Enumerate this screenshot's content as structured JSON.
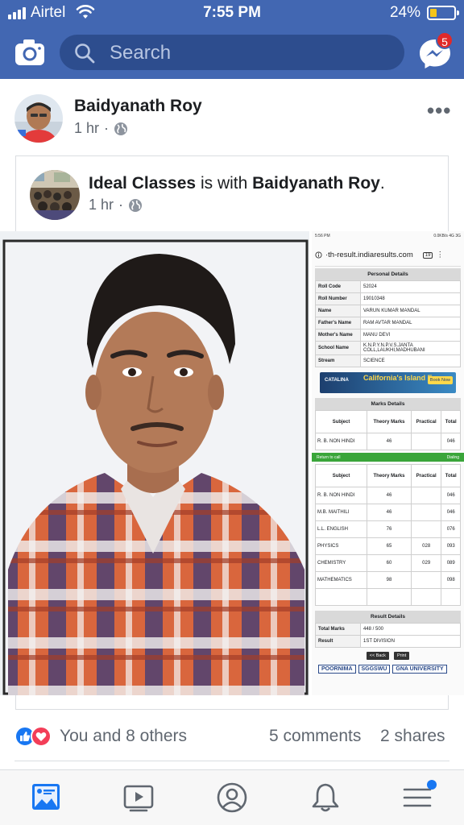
{
  "status_bar": {
    "carrier": "Airtel",
    "time": "7:55 PM",
    "battery_percent": "24%",
    "battery_level": 0.24
  },
  "header": {
    "search_placeholder": "Search",
    "messenger_badge": "5",
    "colors": {
      "bar": "#4267b2",
      "search": "#2d4d8e",
      "badge": "#e02929"
    }
  },
  "post": {
    "author": "Baidyanath Roy",
    "time": "1 hr",
    "separator": "·",
    "more_label": "•••",
    "audience_icon": "globe-icon"
  },
  "shared_post": {
    "page_name": "Ideal Classes",
    "with_text": "is with",
    "tagged": "Baidyanath Roy",
    "period": ".",
    "time": "1 hr",
    "separator": "·"
  },
  "result_screenshot": {
    "status_time": "5:56 PM",
    "status_right": "0.0KB/s 4G 3G",
    "url": "·th-result.indiaresults.com",
    "tab_count": "19",
    "personal_heading": "Personal Details",
    "personal": [
      {
        "k": "Roll Code",
        "v": "52024"
      },
      {
        "k": "Roll Number",
        "v": "19010348"
      },
      {
        "k": "Name",
        "v": "VARUN KUMAR MANDAL"
      },
      {
        "k": "Father's Name",
        "v": "RAM AVTAR MANDAL"
      },
      {
        "k": "Mother's Name",
        "v": "MANU DEVI"
      },
      {
        "k": "School Name",
        "v": "K.N.P.Y.N.P.V.S.JANTA COLL,LAUKHI,MADHUBANI"
      },
      {
        "k": "Stream",
        "v": "SCIENCE"
      }
    ],
    "ad": {
      "brand": "CATALINA",
      "headline": "California's Island Escape",
      "cta": "Book Now"
    },
    "marks_heading": "Marks Details",
    "marks_columns": [
      "Subject",
      "Theory Marks",
      "Practical",
      "Total"
    ],
    "first_row": {
      "subject": "R. B. NON HINDI",
      "theory": "46",
      "practical": "",
      "total": "046"
    },
    "green_bar": {
      "left": "Return to call",
      "right": "Dialing"
    },
    "marks": [
      {
        "subject": "R. B. NON HINDI",
        "theory": "46",
        "practical": "",
        "total": "046"
      },
      {
        "subject": "M.B. MAITHILI",
        "theory": "46",
        "practical": "",
        "total": "046"
      },
      {
        "subject": "L.L. ENGLISH",
        "theory": "76",
        "practical": "",
        "total": "076"
      },
      {
        "subject": "PHYSICS",
        "theory": "65",
        "practical": "028",
        "total": "093"
      },
      {
        "subject": "CHEMISTRY",
        "theory": "60",
        "practical": "029",
        "total": "089"
      },
      {
        "subject": "MATHEMATICS",
        "theory": "98",
        "practical": "",
        "total": "098"
      }
    ],
    "result_heading": "Result Details",
    "result": [
      {
        "k": "Total Marks",
        "v": "448 / 500"
      },
      {
        "k": "Result",
        "v": "1ST DIVISION"
      }
    ],
    "back_button": "<< Back",
    "print_button": "Print",
    "logos": [
      "POORNIMA",
      "SGGSWU",
      "GNA UNIVERSITY"
    ]
  },
  "reactions": {
    "icons": [
      "like-icon",
      "love-icon"
    ],
    "text": "You and 8 others",
    "comments": "5 comments",
    "shares": "2 shares"
  },
  "bottom_nav": {
    "items": [
      "news-feed-icon",
      "watch-icon",
      "profile-icon",
      "notifications-icon",
      "menu-icon"
    ],
    "active": "news-feed-icon",
    "accent": "#1877f2"
  }
}
